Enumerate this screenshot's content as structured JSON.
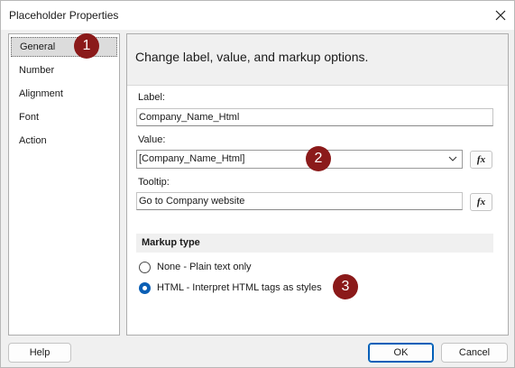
{
  "window": {
    "title": "Placeholder Properties"
  },
  "nav": {
    "items": [
      {
        "label": "General",
        "selected": true
      },
      {
        "label": "Number",
        "selected": false
      },
      {
        "label": "Alignment",
        "selected": false
      },
      {
        "label": "Font",
        "selected": false
      },
      {
        "label": "Action",
        "selected": false
      }
    ]
  },
  "main": {
    "heading": "Change label, value, and markup options.",
    "label_caption": "Label:",
    "label_value": "Company_Name_Html",
    "value_caption": "Value:",
    "value_value": "[Company_Name_Html]",
    "tooltip_caption": "Tooltip:",
    "tooltip_value": "Go to Company website",
    "fx_label": "fx",
    "markup": {
      "title": "Markup type",
      "options": [
        {
          "label": "None - Plain text only",
          "checked": false
        },
        {
          "label": "HTML - Interpret HTML tags as styles",
          "checked": true
        }
      ]
    }
  },
  "footer": {
    "help": "Help",
    "ok": "OK",
    "cancel": "Cancel"
  },
  "callouts": [
    "1",
    "2",
    "3"
  ],
  "colors": {
    "accent": "#0a5fb5",
    "callout": "#8b1a1a",
    "selection": "#dcdcdc"
  }
}
